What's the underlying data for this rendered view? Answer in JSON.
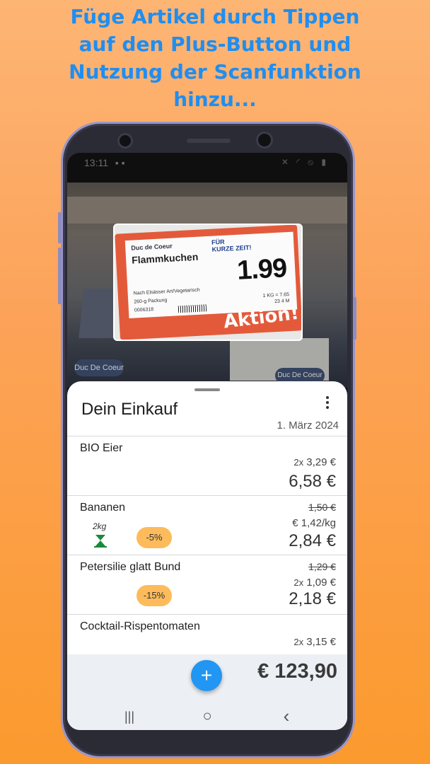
{
  "headline": {
    "line1": "Füge Artikel durch Tippen",
    "line2": "auf den Plus-Button und",
    "line3": "Nutzung der Scanfunktion",
    "line4": "hinzu..."
  },
  "status_bar": {
    "time": "13:11"
  },
  "scanned_tag": {
    "brand": "Duc de Coeur",
    "badge_line1": "FÜR",
    "badge_line2": "KURZE ZEIT!",
    "product": "Flammkuchen",
    "price": "1.99",
    "description": "Nach Elsässer Art/Vegetarisch",
    "pack": "260-g Packung",
    "code": "0006318",
    "unit_price_1": "1 KG = 7.65",
    "unit_price_2": "23      4 M",
    "action": "Aktion!",
    "shelf_logo_1": "Duc De Coeur",
    "shelf_logo_2": "Duc De Coeur"
  },
  "sheet": {
    "title": "Dein Einkauf",
    "date": "1. März 2024",
    "menu_icon": "more-vertical-icon"
  },
  "items": [
    {
      "name": "BIO Eier",
      "qty": "2x",
      "unit_price": "3,29 €",
      "total": "6,58 €"
    },
    {
      "name": "Bananen",
      "old_price": "1,50 €",
      "unit_price": "€ 1,42/kg",
      "weight": "2kg",
      "discount": "-5%",
      "total": "2,84 €"
    },
    {
      "name": "Petersilie glatt Bund",
      "old_price": "1,29 €",
      "qty": "2x",
      "unit_price": "1,09 €",
      "discount": "-15%",
      "total": "2,18 €"
    },
    {
      "name": "Cocktail-Rispentomaten",
      "qty": "2x",
      "unit_price": "3,15 €"
    }
  ],
  "footer": {
    "total": "€ 123,90",
    "add_label": "+"
  },
  "nav": {
    "recent": "|||",
    "home": "○",
    "back": "‹"
  },
  "colors": {
    "accent": "#2196f3",
    "headline": "#1f8ef1",
    "discount": "#fdbb5b",
    "background": "#fca35a"
  }
}
